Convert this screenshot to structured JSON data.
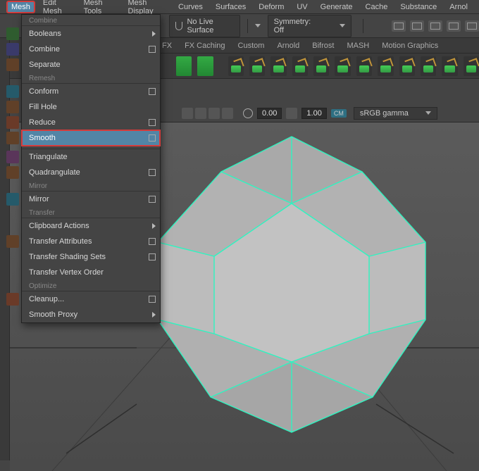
{
  "menubar": {
    "items": [
      "Mesh",
      "Edit Mesh",
      "Mesh Tools",
      "Mesh Display",
      "Curves",
      "Surfaces",
      "Deform",
      "UV",
      "Generate",
      "Cache",
      "Substance",
      "Arnol"
    ]
  },
  "optbar": {
    "live_surface": "No Live Surface",
    "symmetry": "Symmetry: Off"
  },
  "shelf": {
    "tabs": [
      "FX",
      "FX Caching",
      "Custom",
      "Arnold",
      "Bifrost",
      "MASH",
      "Motion Graphics"
    ]
  },
  "midbar": {
    "val1": "0.00",
    "val2": "1.00",
    "cm_badge": "CM",
    "colorspace": "sRGB gamma"
  },
  "menu": {
    "sections": {
      "combine": "Combine",
      "remesh": "Remesh",
      "mirror": "Mirror",
      "transfer": "Transfer",
      "optimize": "Optimize"
    },
    "items": {
      "booleans": "Booleans",
      "combine": "Combine",
      "separate": "Separate",
      "conform": "Conform",
      "fillhole": "Fill Hole",
      "reduce": "Reduce",
      "smooth": "Smooth",
      "triangulate": "Triangulate",
      "quadrangulate": "Quadrangulate",
      "mirror": "Mirror",
      "clipboard": "Clipboard Actions",
      "transferattr": "Transfer Attributes",
      "transfershade": "Transfer Shading Sets",
      "transfervert": "Transfer Vertex Order",
      "cleanup": "Cleanup...",
      "smoothproxy": "Smooth Proxy"
    }
  },
  "icon_colors": {
    "booleans": "#2f5c2f",
    "combine": "#333355",
    "separate": "#604b28",
    "conform": "#255a6a",
    "fillhole": "#604028",
    "reduce": "#6a3a28",
    "smooth": "#6a4a28",
    "triangulate": "#5a355a",
    "quadrangulate": "#604028",
    "mirror": "#255a6a",
    "transferattr": "#604028",
    "cleanup": "#6a3a28"
  }
}
